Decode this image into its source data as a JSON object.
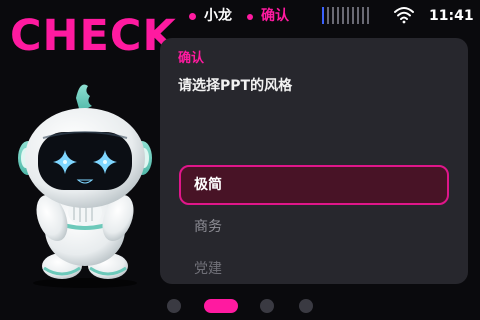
{
  "title": "CHECK",
  "status_bar": {
    "assistant_name": "小龙",
    "mode": "确认",
    "battery_level": 0.2,
    "time": "11:41",
    "icons": [
      "wifi-icon",
      "battery-icon"
    ]
  },
  "dialog": {
    "title": "确认",
    "prompt": "请选择PPT的风格",
    "options": [
      {
        "label": "极简",
        "selected": true
      },
      {
        "label": "商务",
        "selected": false
      },
      {
        "label": "党建",
        "selected": false
      }
    ]
  },
  "pager": {
    "pages": 4,
    "active_index": 1
  },
  "colors": {
    "accent": "#ff1aa0",
    "card_bg": "#27272d",
    "selected_bg": "#481326",
    "background": "#0a0a0d"
  }
}
